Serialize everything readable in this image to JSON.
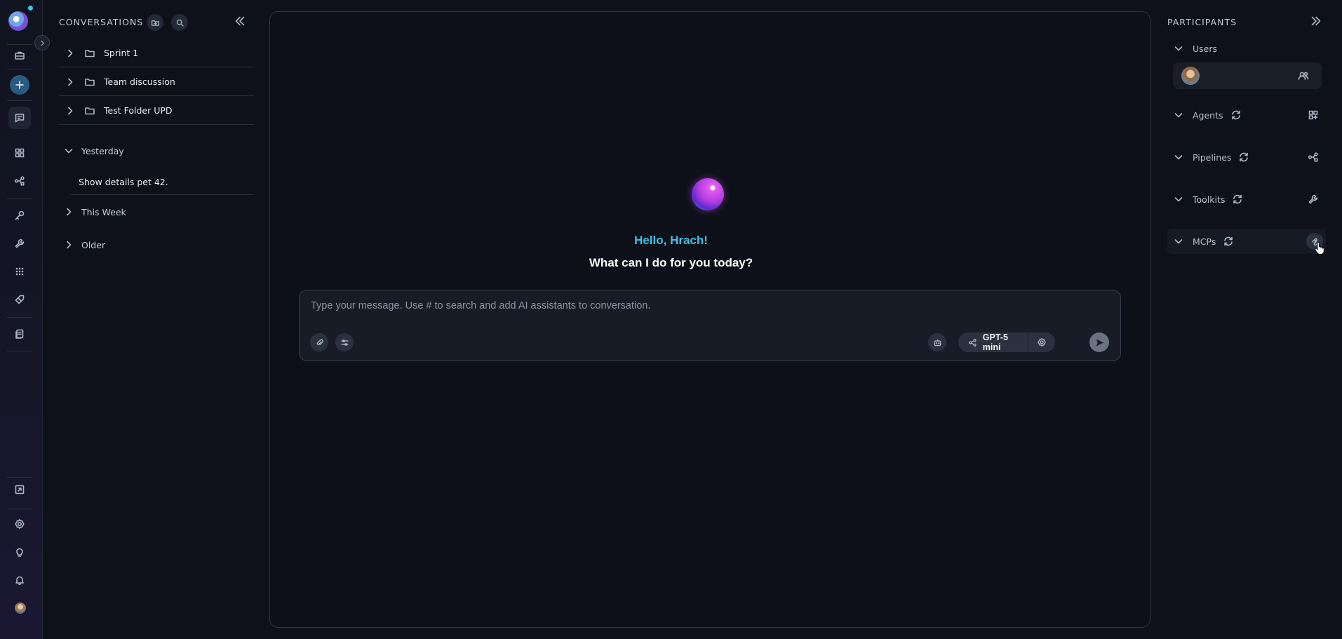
{
  "rail": {
    "icons": [
      "logo-icon",
      "briefcase-icon",
      "plus-icon",
      "chat-icon",
      "grid-icon",
      "pipeline-icon",
      "key-icon",
      "wrench-icon",
      "apps-icon",
      "tag-icon",
      "documents-icon",
      "export-icon",
      "settings-icon",
      "lightbulb-icon",
      "bell-icon",
      "avatar"
    ],
    "active": "chat-icon",
    "accent": "#2a5b82"
  },
  "conversations": {
    "title": "CONVERSATIONS",
    "folders": [
      {
        "label": "Sprint 1"
      },
      {
        "label": "Team discussion"
      },
      {
        "label": "Test Folder UPD"
      }
    ],
    "groups": {
      "yesterday": {
        "label": "Yesterday",
        "expanded": true,
        "items": [
          "Show details pet 42."
        ]
      },
      "this_week": {
        "label": "This Week",
        "expanded": false
      },
      "older": {
        "label": "Older",
        "expanded": false
      }
    }
  },
  "chat": {
    "greeting": "Hello, Hrach!",
    "question": "What can I do for you today?",
    "input_placeholder": "Type your message. Use # to search and add AI assistants to conversation.",
    "input_value": "",
    "model": "GPT-5 mini",
    "accent": "#3fc3e8"
  },
  "participants": {
    "title": "PARTICIPANTS",
    "sections": [
      {
        "label": "Users",
        "expanded": true
      },
      {
        "label": "Agents",
        "expanded": true
      },
      {
        "label": "Pipelines",
        "expanded": true
      },
      {
        "label": "Toolkits",
        "expanded": true
      },
      {
        "label": "MCPs",
        "expanded": true
      }
    ]
  }
}
